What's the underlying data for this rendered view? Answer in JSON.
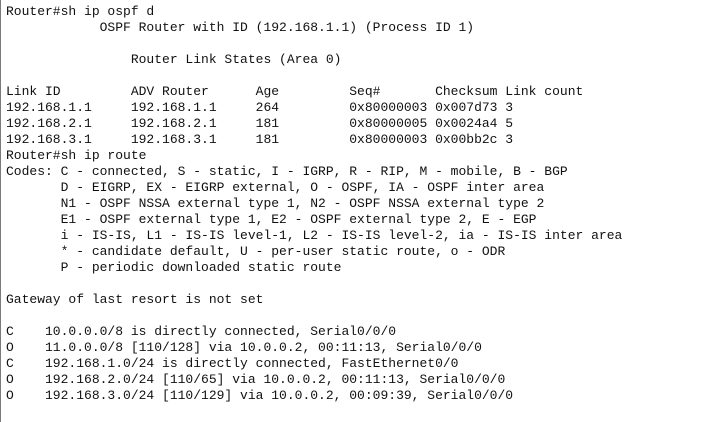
{
  "terminal": {
    "background": "#ffffff",
    "text_color": "#111111",
    "lines": [
      "Router#sh ip ospf d",
      "            OSPF Router with ID (192.168.1.1) (Process ID 1)",
      "",
      "                Router Link States (Area 0)",
      "",
      "Link ID         ADV Router      Age         Seq#       Checksum Link count",
      "192.168.1.1     192.168.1.1     264         0x80000003 0x007d73 3",
      "192.168.2.1     192.168.2.1     181         0x80000005 0x0024a4 5",
      "192.168.3.1     192.168.3.1     181         0x80000003 0x00bb2c 3",
      "Router#sh ip route",
      "Codes: C - connected, S - static, I - IGRP, R - RIP, M - mobile, B - BGP",
      "       D - EIGRP, EX - EIGRP external, O - OSPF, IA - OSPF inter area",
      "       N1 - OSPF NSSA external type 1, N2 - OSPF NSSA external type 2",
      "       E1 - OSPF external type 1, E2 - OSPF external type 2, E - EGP",
      "       i - IS-IS, L1 - IS-IS level-1, L2 - IS-IS level-2, ia - IS-IS inter area",
      "       * - candidate default, U - per-user static route, o - ODR",
      "       P - periodic downloaded static route",
      "",
      "Gateway of last resort is not set",
      "",
      "C    10.0.0.0/8 is directly connected, Serial0/0/0",
      "O    11.0.0.0/8 [110/128] via 10.0.0.2, 00:11:13, Serial0/0/0",
      "C    192.168.1.0/24 is directly connected, FastEthernet0/0",
      "O    192.168.2.0/24 [110/65] via 10.0.0.2, 00:11:13, Serial0/0/0",
      "O    192.168.3.0/24 [110/129] via 10.0.0.2, 00:09:39, Serial0/0/0"
    ]
  }
}
